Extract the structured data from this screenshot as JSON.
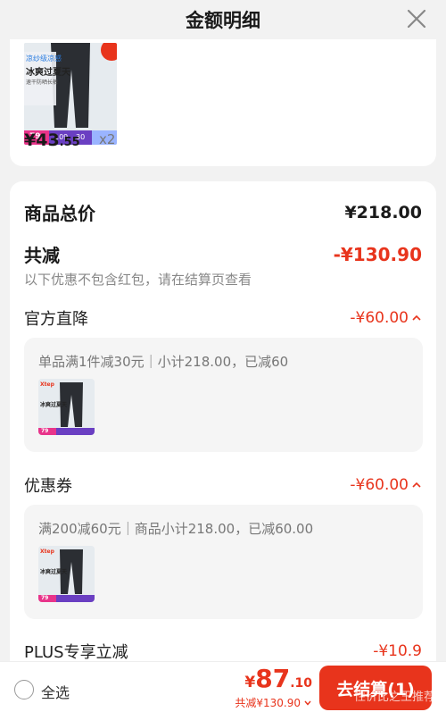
{
  "header": {
    "title": "金额明细"
  },
  "product_card": {
    "price_int": "¥43",
    "price_dec": ".55",
    "quantity": "x2",
    "thumb": {
      "banner_line1": "凉纱级凉感",
      "banner_line2": "冰爽过夏天",
      "banner_line3": "速干防晒长裤",
      "tag_price": "79",
      "tag_a": "109",
      "tag_b": "30"
    }
  },
  "summary": {
    "goods_total_label": "商品总价",
    "goods_total_value": "¥218.00",
    "total_reduce_label": "共减",
    "total_reduce_value": "-¥130.90",
    "note": "以下优惠不包含红包，请在结算页查看"
  },
  "discounts": [
    {
      "label": "官方直降",
      "value": "-¥60.00",
      "detail": "单品满1件减30元｜小计218.00，已减60",
      "thumb_brand": "Xtep",
      "thumb_line1": "冰爽过夏天",
      "thumb_price": "79"
    },
    {
      "label": "优惠券",
      "value": "-¥60.00",
      "detail": "满200减60元｜商品小计218.00，已减60.00",
      "thumb_brand": "Xtep",
      "thumb_line1": "冰爽过夏天",
      "thumb_price": "79"
    }
  ],
  "plus": {
    "label": "PLUS专享立减",
    "value": "-¥10.9"
  },
  "bottom_bar": {
    "select_all": "全选",
    "total_sym": "¥",
    "total_int": "87",
    "total_dec": ".10",
    "saved": "共减¥130.90",
    "checkout": "去结算(1)",
    "watermark": "性价比之王推荐"
  },
  "colors": {
    "accent": "#e8341c",
    "background": "#f2f2f2"
  }
}
